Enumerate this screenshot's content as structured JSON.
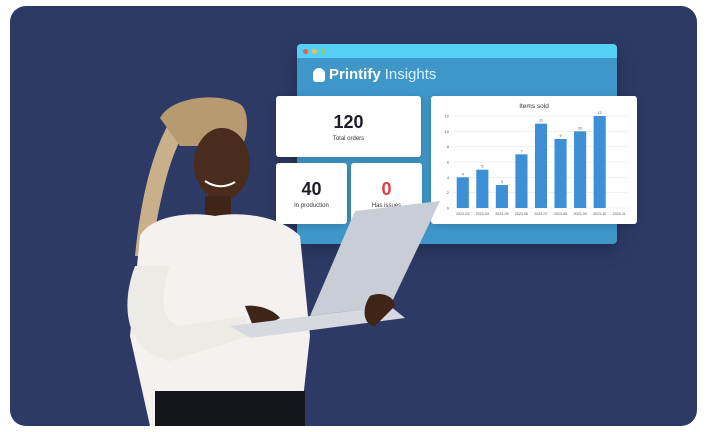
{
  "brand": {
    "name": "Printify",
    "suffix": "Insights"
  },
  "stats": {
    "total_orders": {
      "value": "120",
      "label": "Total orders"
    },
    "in_production": {
      "value": "40",
      "label": "In production"
    },
    "has_issues": {
      "value": "0",
      "label": "Has issues"
    }
  },
  "colors": {
    "background": "#2d3a66",
    "window": "#3f97c9",
    "titlebar": "#56d0f2",
    "bar": "#3d8fd6",
    "issues": "#e23b4a"
  },
  "chart_data": {
    "type": "bar",
    "title": "Items sold",
    "categories": [
      "2023-03",
      "2023-04",
      "2023-05",
      "2023-06",
      "2023-07",
      "2023-08",
      "2023-09",
      "2023-10",
      "2023-11"
    ],
    "values": [
      4,
      5,
      3,
      7,
      11,
      9,
      10,
      12
    ],
    "ylim": [
      0,
      12
    ],
    "yticks": [
      0,
      2,
      4,
      6,
      8,
      10,
      12
    ],
    "grid": true
  }
}
